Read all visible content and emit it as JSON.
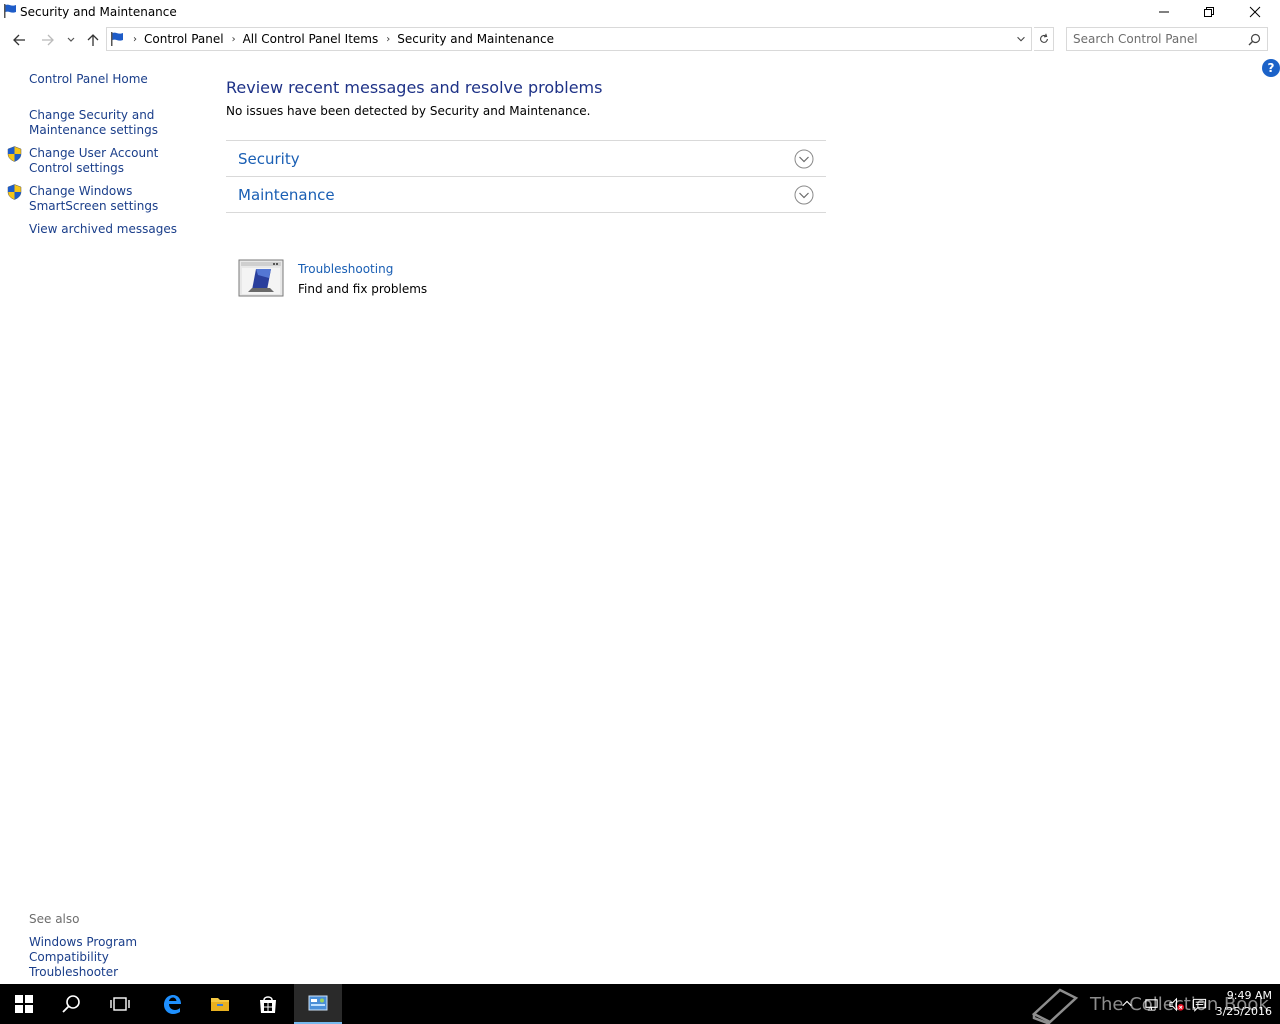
{
  "window": {
    "title": "Security and Maintenance",
    "controls": [
      "minimize",
      "restore",
      "close"
    ]
  },
  "address": {
    "crumbs": [
      "Control Panel",
      "All Control Panel Items",
      "Security and Maintenance"
    ],
    "search_placeholder": "Search Control Panel"
  },
  "sidebar": {
    "home": "Control Panel Home",
    "items": [
      {
        "label": "Change Security and Maintenance settings",
        "icon": "none"
      },
      {
        "label": "Change User Account Control settings",
        "icon": "shield-icon"
      },
      {
        "label": "Change Windows SmartScreen settings",
        "icon": "shield-icon"
      },
      {
        "label": "View archived messages",
        "icon": "none"
      }
    ],
    "see_also_title": "See also",
    "see_also_items": [
      "Windows Program Compatibility Troubleshooter"
    ]
  },
  "main": {
    "title": "Review recent messages and resolve problems",
    "subtitle": "No issues have been detected by Security and Maintenance.",
    "sections": [
      {
        "label": "Security",
        "expanded": false
      },
      {
        "label": "Maintenance",
        "expanded": false
      }
    ],
    "troubleshooting": {
      "label": "Troubleshooting",
      "description": "Find and fix problems"
    }
  },
  "taskbar": {
    "time": "9:49 AM",
    "date": "3/25/2016",
    "watermark": "The Collection Book",
    "active_app": "control-panel",
    "colors": {
      "background": "#000000",
      "accent": "#76b9ed"
    }
  },
  "colors": {
    "link": "#1a3e8a",
    "heading": "#1e3287",
    "section_link": "#1a5fb4",
    "help": "#1b62c8"
  }
}
